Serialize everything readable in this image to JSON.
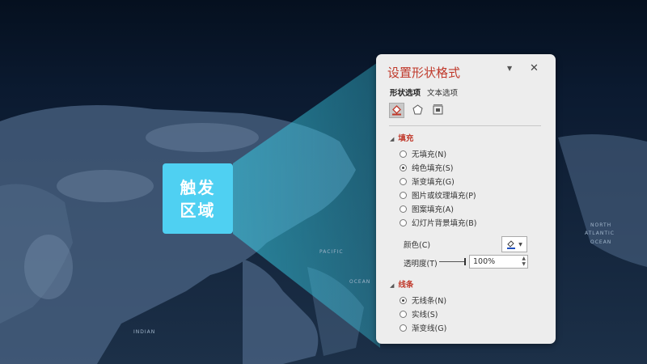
{
  "trigger_area": {
    "line1": "触发",
    "line2": "区域"
  },
  "map_labels": {
    "pacific": "PACIFIC",
    "ocean": "OCEAN",
    "indian": "INDIAN",
    "north": "NORTH",
    "atlantic": "ATLANTIC",
    "ocean2": "OCEAN"
  },
  "panel": {
    "title": "设置形状格式",
    "pin_icon": "▼",
    "close_icon": "✕",
    "tabs": [
      "形状选项",
      "文本选项"
    ],
    "fill_section": {
      "label": "填充",
      "options": [
        "无填充(N)",
        "纯色填充(S)",
        "渐变填充(G)",
        "图片或纹理填充(P)",
        "图案填充(A)",
        "幻灯片背景填充(B)"
      ],
      "selected_index": 1,
      "color_label": "颜色(C)",
      "transparency_label": "透明度(T)",
      "transparency_value": "100%"
    },
    "line_section": {
      "label": "线条",
      "options": [
        "无线条(N)",
        "实线(S)",
        "渐变线(G)"
      ],
      "selected_index": 0
    }
  },
  "colors": {
    "accent": "#4fd0f2",
    "title_red": "#c0392b",
    "panel_bg": "#ededed",
    "beam": "#3ad0e8"
  }
}
